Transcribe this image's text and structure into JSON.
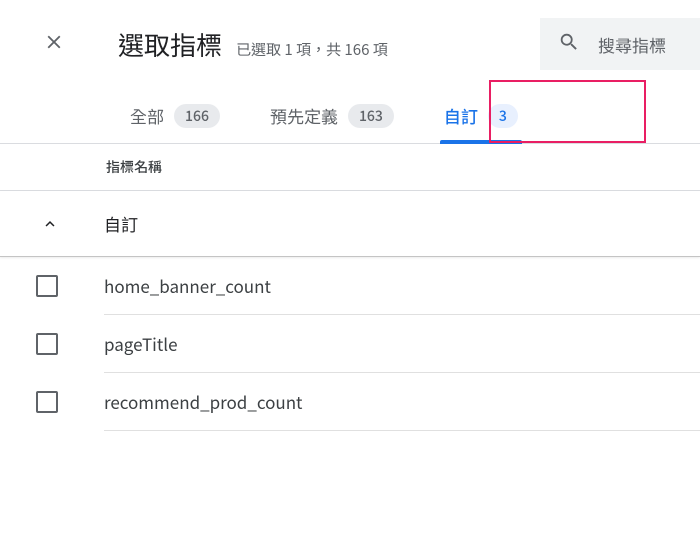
{
  "header": {
    "title": "選取指標",
    "subtitle": "已選取 1 項，共 166 項"
  },
  "search": {
    "placeholder": "搜尋指標"
  },
  "tabs": {
    "all": {
      "label": "全部",
      "count": "166"
    },
    "predefined": {
      "label": "預先定義",
      "count": "163"
    },
    "custom": {
      "label": "自訂",
      "count": "3"
    }
  },
  "column_header": "指標名稱",
  "group": {
    "title": "自訂"
  },
  "items": [
    {
      "label": "home_banner_count"
    },
    {
      "label": "pageTitle"
    },
    {
      "label": "recommend_prod_count"
    }
  ]
}
